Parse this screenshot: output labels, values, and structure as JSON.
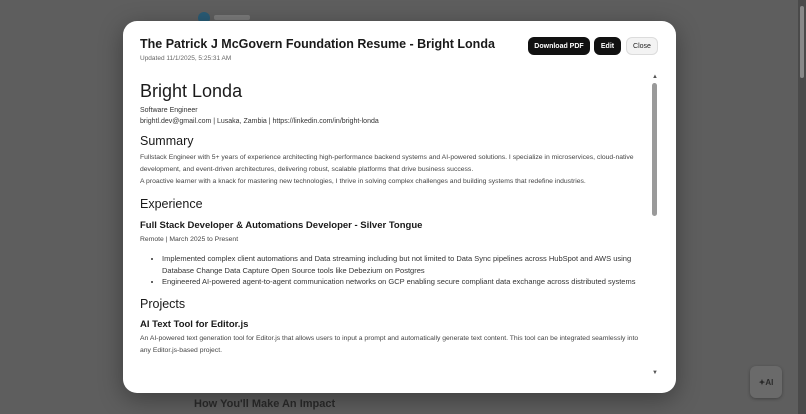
{
  "background": {
    "section_heading": "How You'll Make An Impact",
    "ai_button": "✦AI"
  },
  "modal": {
    "title": "The Patrick J McGovern Foundation Resume - Bright Londa",
    "updated": "Updated 11/1/2025, 5:25:31 AM",
    "buttons": {
      "download": "Download PDF",
      "edit": "Edit",
      "close": "Close"
    }
  },
  "resume": {
    "name": "Bright Londa",
    "role": "Software Engineer",
    "contact": "brightl.dev@gmail.com | Lusaka, Zambia | https://linkedin.com/in/bright-londa",
    "summary_heading": "Summary",
    "summary_1": "Fullstack Engineer with 5+ years of experience architecting high-performance backend systems and AI-powered solutions. I specialize in microservices, cloud-native development, and event-driven architectures, delivering robust, scalable platforms that drive business success.",
    "summary_2": "A proactive learner with a knack for mastering new technologies, I thrive in solving complex challenges and building systems that redefine industries.",
    "experience_heading": "Experience",
    "job": {
      "title": "Full Stack Developer & Automations Developer - Silver Tongue",
      "meta": "Remote | March 2025 to Present",
      "bullets": [
        "Implemented complex client automations and Data streaming including but not limited to Data Sync pipelines across HubSpot and AWS using Database Change Data Capture Open Source tools like Debezium on Postgres",
        "Engineered AI-powered agent-to-agent communication networks on GCP enabling secure compliant data exchange across distributed systems"
      ]
    },
    "projects_heading": "Projects",
    "project": {
      "title": "AI Text Tool for Editor.js",
      "description": "An AI-powered text generation tool for Editor.js that allows users to input a prompt and automatically generate text content. This tool can be integrated seamlessly into any Editor.js-based project."
    }
  },
  "icons": {
    "scroll_up": "▲",
    "scroll_down": "▼"
  }
}
